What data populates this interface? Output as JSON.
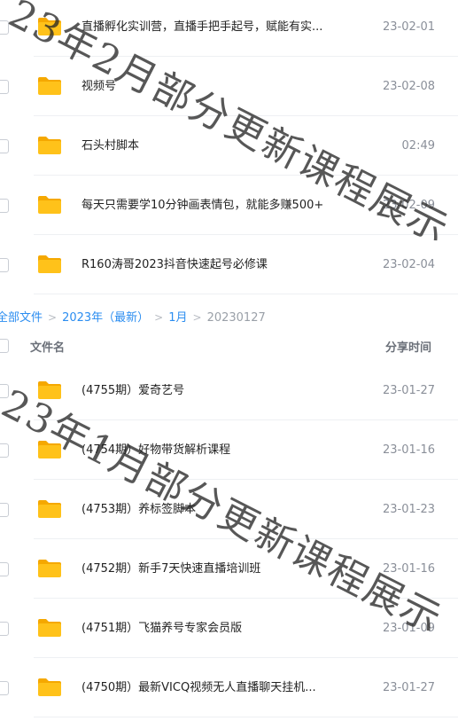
{
  "group1": [
    {
      "name": "直播孵化实训营，直播手把手起号，赋能有实...",
      "date": "23-02-01"
    },
    {
      "name": "视频号",
      "date": "23-02-08"
    },
    {
      "name": "石头村脚本",
      "date": "02:49"
    },
    {
      "name": "每天只需要学10分钟画表情包，就能多赚500+",
      "date": "23-02-09"
    },
    {
      "name": "R160涛哥2023抖音快速起号必修课",
      "date": "23-02-04"
    }
  ],
  "breadcrumb": {
    "items": [
      "全部文件",
      "2023年（最新）",
      "1月",
      "20230127"
    ]
  },
  "header": {
    "name_col": "文件名",
    "time_col": "分享时间"
  },
  "group2": [
    {
      "name": "(4755期）爱奇艺号",
      "date": "23-01-27"
    },
    {
      "name": "(4754期）好物带货解析课程",
      "date": "23-01-16"
    },
    {
      "name": "(4753期）养标签脚本",
      "date": "23-01-23"
    },
    {
      "name": "(4752期）新手7天快速直播培训班",
      "date": "23-01-16"
    },
    {
      "name": "(4751期）飞猫养号专家会员版",
      "date": "23-01-09"
    },
    {
      "name": "(4750期）最新VICQ视频无人直播聊天挂机...",
      "date": "23-01-27"
    }
  ],
  "watermarks": {
    "top": "23年2月部分更新课程展示",
    "bottom": "23年1月部分更新课程展示"
  },
  "colors": {
    "folder": "#ffc21a",
    "folder_tab": "#f5a800",
    "link": "#2b8df0"
  },
  "icons": {
    "folder": "folder-icon",
    "checkbox": "checkbox-icon",
    "chevron": "chevron-right-icon"
  }
}
